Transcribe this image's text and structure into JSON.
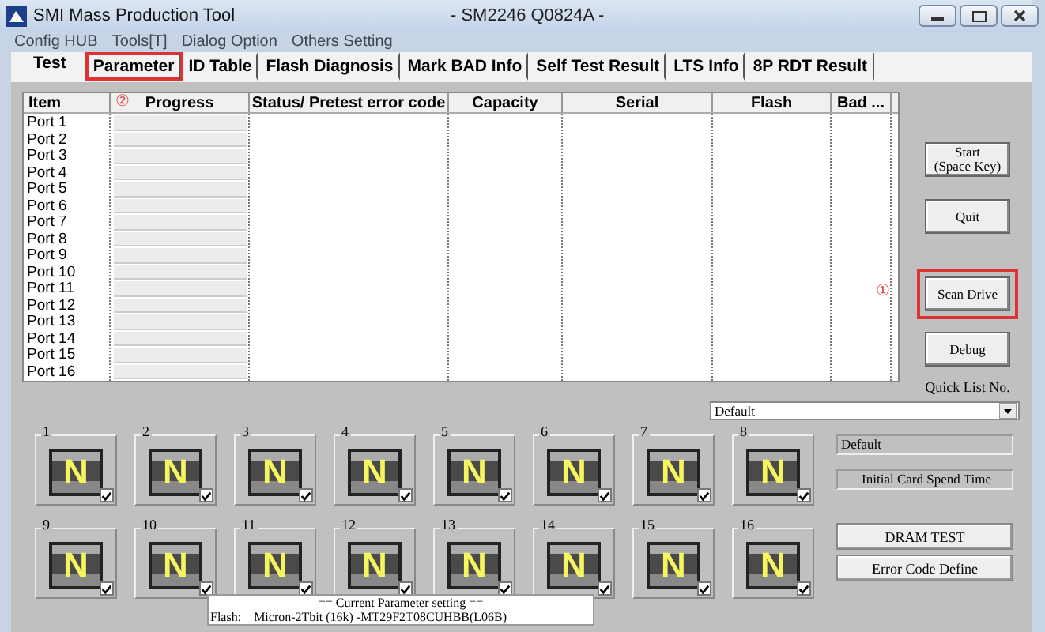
{
  "window": {
    "title": "SMI Mass Production Tool",
    "subtitle": "- SM2246 Q0824A -"
  },
  "menu": [
    "Config HUB",
    "Tools[T]",
    "Dialog Option",
    "Others Setting"
  ],
  "tabs": [
    {
      "label": "Test",
      "selected": true,
      "highlighted": false
    },
    {
      "label": "Parameter",
      "selected": false,
      "highlighted": true
    },
    {
      "label": "ID Table",
      "selected": false,
      "highlighted": false
    },
    {
      "label": "Flash Diagnosis",
      "selected": false,
      "highlighted": false
    },
    {
      "label": "Mark BAD Info",
      "selected": false,
      "highlighted": false
    },
    {
      "label": "Self Test Result",
      "selected": false,
      "highlighted": false
    },
    {
      "label": "LTS Info",
      "selected": false,
      "highlighted": false
    },
    {
      "label": "8P RDT Result",
      "selected": false,
      "highlighted": false
    }
  ],
  "table": {
    "columns": [
      "Item",
      "Progress",
      "Status/ Pretest error code",
      "Capacity",
      "Serial",
      "Flash",
      "Bad ..."
    ],
    "rows": [
      {
        "item": "Port 1",
        "level": 0
      },
      {
        "item": "Port 2",
        "level": 0
      },
      {
        "item": "Port 3",
        "level": 0
      },
      {
        "item": "Port 4",
        "level": 0
      },
      {
        "item": "Port 5",
        "level": 0
      },
      {
        "item": "Port 6",
        "level": 0
      },
      {
        "item": "Port 7",
        "level": 0
      },
      {
        "item": "Port 8",
        "level": 0
      },
      {
        "item": "Port 9",
        "level": 0
      },
      {
        "item": "Port 10",
        "level": 0
      },
      {
        "item": "Port 11",
        "level": 0
      },
      {
        "item": "Port 12",
        "level": 0
      },
      {
        "item": "Port 13",
        "level": 0
      },
      {
        "item": "Port 14",
        "level": 0
      },
      {
        "item": "Port 15",
        "level": 0
      },
      {
        "item": "Port 16",
        "level": 0
      }
    ]
  },
  "progress_annotation": "②",
  "scan_annotation": "①",
  "side_buttons": [
    {
      "label": "Start\n(Space Key)",
      "highlighted": false
    },
    {
      "label": "Quit",
      "highlighted": false
    },
    {
      "label": "Scan Drive",
      "highlighted": true
    },
    {
      "label": "Debug",
      "highlighted": false
    }
  ],
  "quick_list": {
    "label": "Quick List No.",
    "value": "Default"
  },
  "ports": [
    {
      "label": "1",
      "letter": "N",
      "checked": true
    },
    {
      "label": "2",
      "letter": "N",
      "checked": true
    },
    {
      "label": "3",
      "letter": "N",
      "checked": true
    },
    {
      "label": "4",
      "letter": "N",
      "checked": true
    },
    {
      "label": "5",
      "letter": "N",
      "checked": true
    },
    {
      "label": "6",
      "letter": "N",
      "checked": true
    },
    {
      "label": "7",
      "letter": "N",
      "checked": true
    },
    {
      "label": "8",
      "letter": "N",
      "checked": true
    },
    {
      "label": "9",
      "letter": "N",
      "checked": true
    },
    {
      "label": "10",
      "letter": "N",
      "checked": true
    },
    {
      "label": "11",
      "letter": "N",
      "checked": true
    },
    {
      "label": "12",
      "letter": "N",
      "checked": true
    },
    {
      "label": "13",
      "letter": "N",
      "checked": true
    },
    {
      "label": "14",
      "letter": "N",
      "checked": true
    },
    {
      "label": "15",
      "letter": "N",
      "checked": true
    },
    {
      "label": "16",
      "letter": "N",
      "checked": true
    }
  ],
  "list_name": "Default",
  "spend_time": "Initial Card Spend Time",
  "bottom_buttons": [
    "DRAM TEST",
    "Error Code Define"
  ],
  "parameter_box": {
    "title": "== Current Parameter setting ==",
    "flash_label": "Flash:",
    "flash_value": "Micron-2Tbit (16k) -MT29F2T08CUHBB(L06B)"
  }
}
